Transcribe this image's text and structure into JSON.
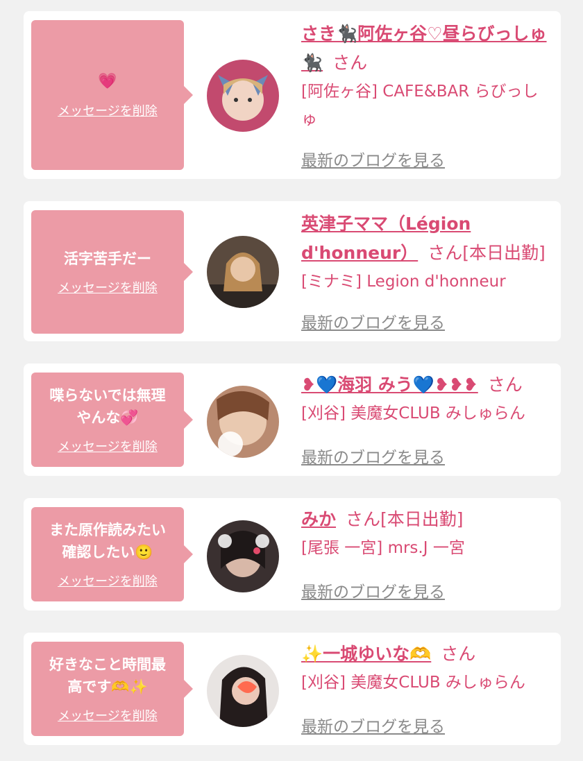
{
  "delete_label": "メッセージを削除",
  "blog_label": "最新のブログを見る",
  "cards": [
    {
      "message": "💗",
      "name": "さき🐈‍⬛阿佐ヶ谷♡昼らびっしゅ🐈‍⬛",
      "san": "さん",
      "status": "",
      "shop": "[阿佐ヶ谷] CAFE&BAR らびっしゅ"
    },
    {
      "message": "活字苦手だー",
      "name": "英津子ママ（Légion d'honneur）",
      "san": "さん",
      "status": "[本日出勤]",
      "shop": "[ミナミ] Legion d'honneur"
    },
    {
      "message": "喋らないでは無理\nやんな💞",
      "name": "❥💙海羽 みう💙❥❥❥",
      "san": "さん",
      "status": "",
      "shop": "[刈谷] 美魔女CLUB みしゅらん"
    },
    {
      "message": "また原作読みたい\n確認したい🙂",
      "name": "みか",
      "san": "さん",
      "status": "[本日出勤]",
      "shop": "[尾張 一宮] mrs.J 一宮"
    },
    {
      "message": "好きなこと時間最\n高です🫶✨",
      "name": "✨一城ゆいな🫶",
      "san": "さん",
      "status": "",
      "shop": "[刈谷] 美魔女CLUB みしゅらん"
    }
  ]
}
